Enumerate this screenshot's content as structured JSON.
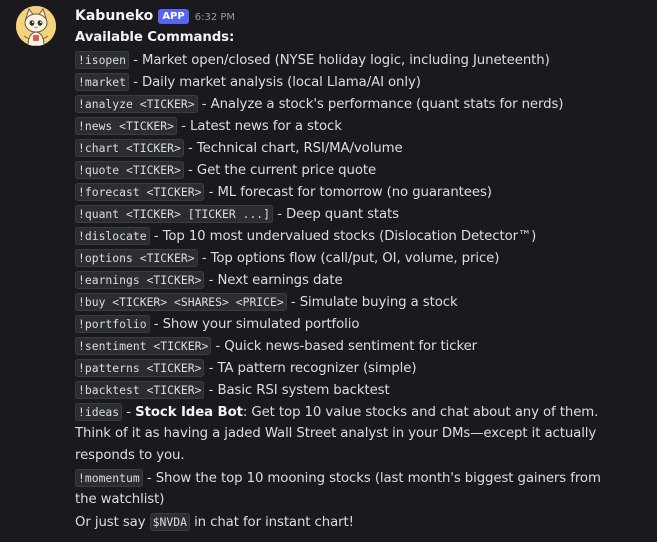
{
  "message": {
    "username": "Kabuneko",
    "app_tag": "APP",
    "timestamp": "6:32 PM",
    "heading": "Available Commands:",
    "commands": [
      {
        "code": "!isopen",
        "desc": "Market open/closed (NYSE holiday logic, including Juneteenth)"
      },
      {
        "code": "!market",
        "desc": "Daily market analysis (local Llama/AI only)"
      },
      {
        "code": "!analyze <TICKER>",
        "desc": "Analyze a stock's performance (quant stats for nerds)"
      },
      {
        "code": "!news <TICKER>",
        "desc": "Latest news for a stock"
      },
      {
        "code": "!chart <TICKER>",
        "desc": "Technical chart, RSI/MA/volume"
      },
      {
        "code": "!quote <TICKER>",
        "desc": "Get the current price quote"
      },
      {
        "code": "!forecast <TICKER>",
        "desc": "ML forecast for tomorrow (no guarantees)"
      },
      {
        "code": "!quant <TICKER> [TICKER ...]",
        "desc": "Deep quant stats"
      },
      {
        "code": "!dislocate",
        "desc": "Top 10 most undervalued stocks (Dislocation Detector™)"
      },
      {
        "code": "!options <TICKER>",
        "desc": "Top options flow (call/put, OI, volume, price)"
      },
      {
        "code": "!earnings <TICKER>",
        "desc": "Next earnings date"
      },
      {
        "code": "!buy <TICKER> <SHARES> <PRICE>",
        "desc": "Simulate buying a stock"
      },
      {
        "code": "!portfolio",
        "desc": "Show your simulated portfolio"
      },
      {
        "code": "!sentiment <TICKER>",
        "desc": "Quick news-based sentiment for ticker"
      },
      {
        "code": "!patterns <TICKER>",
        "desc": "TA pattern recognizer (simple)"
      },
      {
        "code": "!backtest <TICKER>",
        "desc": "Basic RSI system backtest"
      }
    ],
    "ideas": {
      "code": "!ideas",
      "bold": "Stock Idea Bot",
      "line1_rest": ": Get top 10 value stocks and chat about any of them.",
      "line2": "Think of it as having a jaded Wall Street analyst in your DMs—except it actually",
      "line3": "responds to you."
    },
    "momentum": {
      "code": "!momentum",
      "line1_rest": "Show the top 10 mooning stocks (last month's biggest gainers from",
      "line2": "the watchlist)"
    },
    "footer": {
      "prefix": "Or just say",
      "code": "$NVDA",
      "suffix": "in chat for instant chart!"
    },
    "dash": "-"
  },
  "icons": {
    "avatar": "cat-avatar-icon"
  },
  "colors": {
    "background": "#1a1a1e",
    "app_tag": "#5865f2",
    "code_bg": "#2b2d31",
    "text": "#dbdee1"
  }
}
